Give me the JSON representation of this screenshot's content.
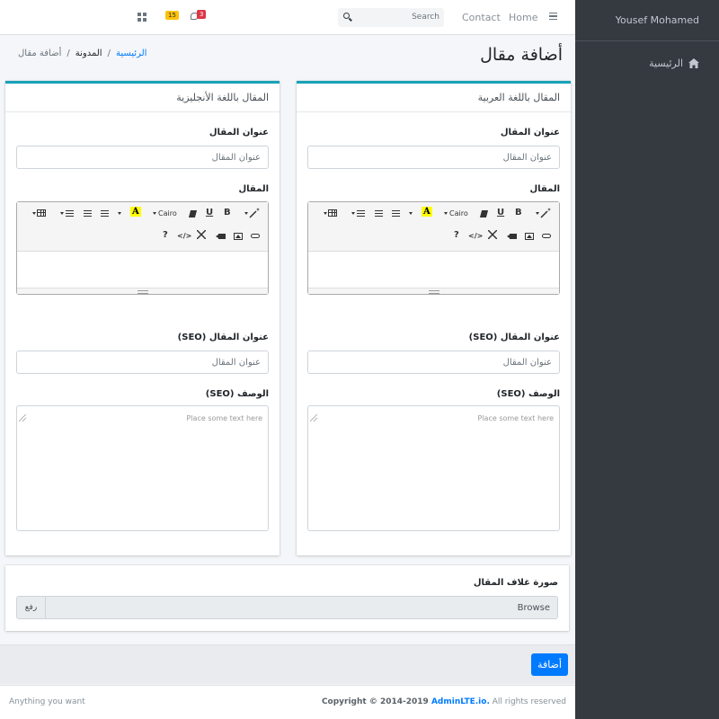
{
  "sidebar": {
    "user_name": "Yousef Mohamed",
    "items": [
      {
        "label": "الرئيسية",
        "icon": "home-icon"
      }
    ]
  },
  "navbar": {
    "links": [
      "Home",
      "Contact"
    ],
    "search_placeholder": "Search",
    "messages_count": "3",
    "notifications_count": "15"
  },
  "header": {
    "title": "أضافة مقال",
    "breadcrumb": [
      "الرئيسية",
      "المدونة",
      "أضافة مقال"
    ],
    "breadcrumb_sep": "/"
  },
  "cards": [
    {
      "header": "المقال باللغة العربية",
      "title_label": "عنوان المقال",
      "title_placeholder": "عنوان المقال",
      "body_label": "المقال",
      "seo_title_label": "عنوان المقال (SEO)",
      "seo_title_placeholder": "عنوان المقال",
      "seo_desc_label": "الوصف (SEO)",
      "seo_desc_placeholder": "Place some text here"
    },
    {
      "header": "المقال باللغة الأنجليزية",
      "title_label": "عنوان المقال",
      "title_placeholder": "عنوان المقال",
      "body_label": "المقال",
      "seo_title_label": "عنوان المقال (SEO)",
      "seo_title_placeholder": "عنوان المقال",
      "seo_desc_label": "الوصف (SEO)",
      "seo_desc_placeholder": "Place some text here"
    }
  ],
  "editor": {
    "font_name": "Cairo",
    "bold": "B",
    "underline": "U",
    "highlight": "A",
    "code": "</>",
    "help": "?"
  },
  "upload": {
    "label": "صورة غلاف المقال",
    "placeholder": "Browse",
    "button": "رفع"
  },
  "submit": {
    "label": "أضافة"
  },
  "footer": {
    "left": "Anything you want",
    "copyright_prefix": "Copyright © 2014-2019 ",
    "brand": "AdminLTE.io.",
    "suffix": " All rights reserved"
  },
  "colors": {
    "accent": "#17a2b8",
    "primary": "#007bff",
    "sidebar": "#343a40"
  }
}
